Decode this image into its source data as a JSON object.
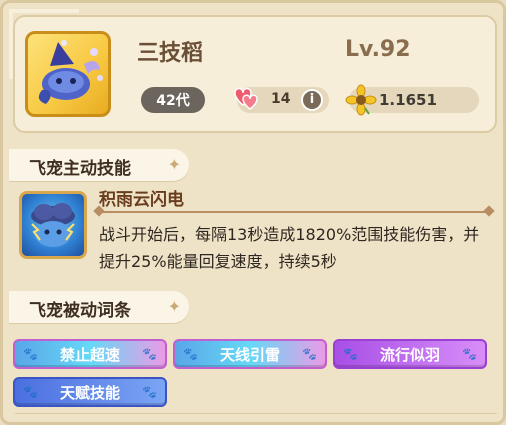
{
  "pet": {
    "name": "三技稻",
    "level": "Lv.92",
    "generation": "42代",
    "love_count": "14",
    "info_glyph": "i",
    "power": "1.1651",
    "portrait_icon": "blue-wizard-cat-icon"
  },
  "active_section": {
    "title": "飞宠主动技能",
    "skill": {
      "name": "积雨云闪电",
      "icon": "storm-cloud-cat-icon",
      "description": "战斗开始后，每隔13秒造成1820%范围技能伤害，并提升25%能量回复速度，持续5秒"
    }
  },
  "passive_section": {
    "title": "飞宠被动词条",
    "tags": [
      {
        "label": "禁止超速",
        "style": "cyan-pink"
      },
      {
        "label": "天线引雷",
        "style": "cyan-pink"
      },
      {
        "label": "流行似羽",
        "style": "purple"
      },
      {
        "label": "天赋技能",
        "style": "blue"
      }
    ]
  },
  "colors": {
    "panel_bg": "#efe3c7",
    "tag_blue": "#4c6fe0",
    "tag_purple": "#a84fe6",
    "tag_cyan": "#5aa6e8",
    "tag_pink": "#ea9be6"
  }
}
